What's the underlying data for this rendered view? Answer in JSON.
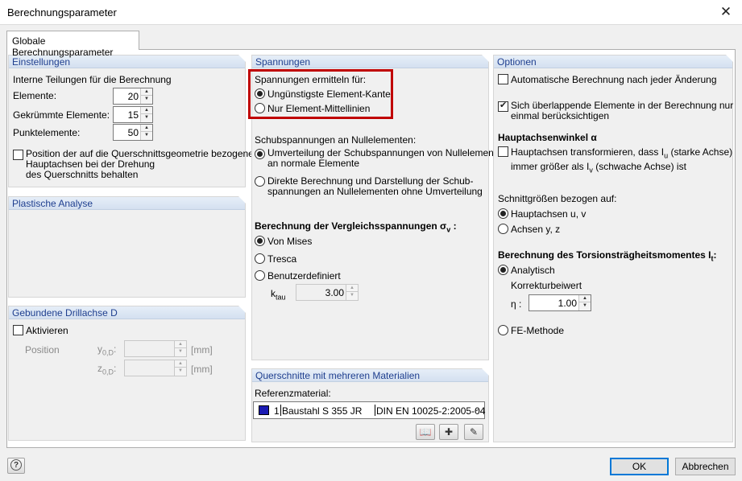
{
  "window": {
    "title": "Berechnungsparameter"
  },
  "tabs": [
    {
      "label": "Globale Berechnungsparameter"
    }
  ],
  "einstellungen": {
    "header": "Einstellungen",
    "interne_label": "Interne Teilungen für die Berechnung",
    "elemente": {
      "label": "Elemente:",
      "value": "20"
    },
    "gekruemmte": {
      "label": "Gekrümmte Elemente:",
      "value": "15"
    },
    "punkt": {
      "label": "Punktelemente:",
      "value": "50"
    },
    "position": {
      "checked": false,
      "line1": "Position der auf die Querschnittsgeometrie bezogenen",
      "line2": "Hauptachsen bei der Drehung",
      "line3": "des Querschnitts behalten"
    }
  },
  "plastische": {
    "header": "Plastische Analyse"
  },
  "drillachse": {
    "header": "Gebundene Drillachse D",
    "aktivieren": {
      "label": "Aktivieren",
      "checked": false
    },
    "position_label": "Position",
    "y_label": "y",
    "y_sub": "0,D",
    "z_label": "z",
    "z_sub": "0,D",
    "colon": ":",
    "unit": "[mm]"
  },
  "spannungen": {
    "header": "Spannungen",
    "ermitteln_label": "Spannungen ermitteln für:",
    "opt_kante": "Ungünstigste Element-Kante",
    "opt_mittellinien": "Nur Element-Mittellinien",
    "schub_label": "Schubspannungen an Nullelementen:",
    "schub_opt1_line1": "Umverteilung der Schubspannungen von Nullelementen",
    "schub_opt1_line2": "an normale Elemente",
    "schub_opt2_line1": "Direkte Berechnung und Darstellung der Schub-",
    "schub_opt2_line2": "spannungen an Nullelementen ohne Umverteilung",
    "vergleich_label": "Berechnung der Vergleichsspannungen σ",
    "vergleich_sub": "v",
    "vergleich_colon": " :",
    "von_mises": "Von Mises",
    "tresca": "Tresca",
    "benutzer": "Benutzerdefiniert",
    "ktau_label": "k",
    "ktau_sub": "tau",
    "ktau_value": "3.00"
  },
  "querschnitte": {
    "header": "Querschnitte mit mehreren Materialien",
    "ref_label": "Referenzmaterial:",
    "material_nr": "1",
    "material_name": "Baustahl S 355 JR",
    "material_norm": "DIN EN 10025-2:2005-04"
  },
  "optionen": {
    "header": "Optionen",
    "auto_berechnung": "Automatische Berechnung nach jeder Änderung",
    "ueberlappend_line1": "Sich überlappende Elemente in der Berechnung nur",
    "ueberlappend_line2": "einmal berücksichtigen",
    "hauptachsen_header": "Hauptachsenwinkel α",
    "transform_line1": "Hauptachsen transformieren, dass I",
    "transform_sub1": "u",
    "transform_line1b": " (starke Achse)",
    "transform_line2": "immer größer als I",
    "transform_sub2": "v",
    "transform_line2b": " (schwache Achse) ist",
    "schnitt_label": "Schnittgrößen bezogen auf:",
    "opt_hauptachsen": "Hauptachsen u, v",
    "opt_achsen": "Achsen y, z",
    "torsion_label": "Berechnung des Torsionsträgheitsmomentes I",
    "torsion_sub": "t",
    "torsion_colon": ":",
    "analytisch": "Analytisch",
    "korrektur": "Korrekturbeiwert",
    "eta_label": "η :",
    "eta_value": "1.00",
    "fe_methode": "FE-Methode"
  },
  "footer": {
    "ok": "OK",
    "cancel": "Abbrechen"
  },
  "colors": {
    "group_header_text": "#1f3f8f",
    "highlight_border": "#c00000",
    "material_swatch": "#1b1bb3"
  }
}
